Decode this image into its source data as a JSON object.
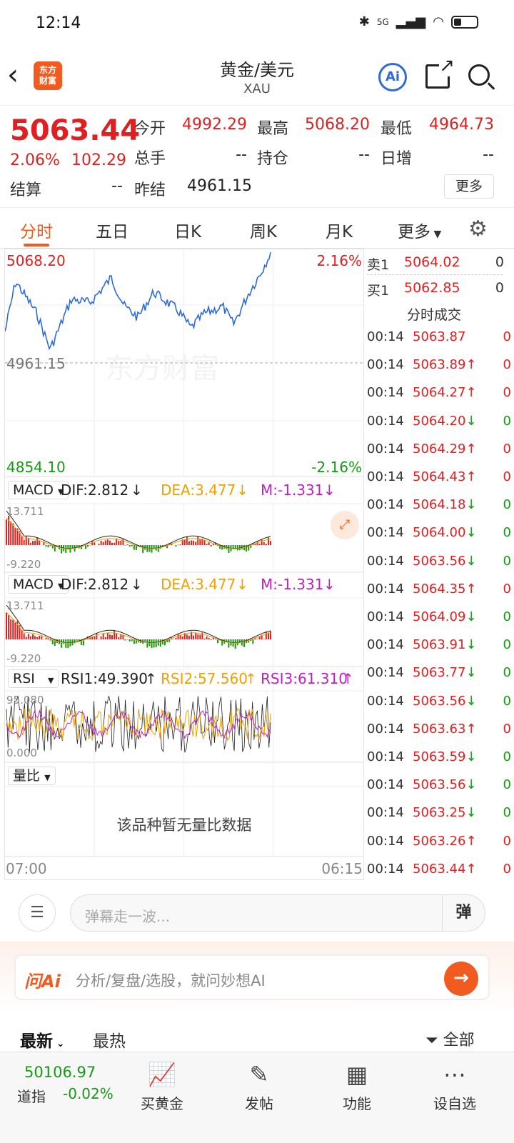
{
  "status": {
    "time": "12:14",
    "network": "5G"
  },
  "header": {
    "title": "黄金/美元",
    "code": "XAU",
    "logo_text": "东方财富",
    "ai_label": "Ai"
  },
  "quote": {
    "price": "5063.44",
    "pct": "2.06%",
    "change": "102.29",
    "labels": {
      "open": "今开",
      "high": "最高",
      "low": "最低",
      "volume": "总手",
      "position": "持仓",
      "daily_inc": "日增",
      "settle": "结算",
      "prev_settle": "昨结"
    },
    "open": "4992.29",
    "high": "5068.20",
    "low": "4964.73",
    "volume": "--",
    "position": "--",
    "daily_inc": "--",
    "settle": "--",
    "prev_settle": "4961.15",
    "more_button": "更多"
  },
  "tabs": [
    "分时",
    "五日",
    "日K",
    "周K",
    "月K",
    "更多"
  ],
  "chart": {
    "top_price": "5068.20",
    "top_pct": "2.16%",
    "mid_price": "4961.15",
    "bottom_price": "4854.10",
    "bottom_pct": "-2.16%",
    "watermark": "东方财富",
    "start_time": "07:00",
    "end_time": "06:15"
  },
  "macd": {
    "name": "MACD",
    "dif": "DIF:2.812",
    "dea": "DEA:3.477",
    "m": "M:-1.331",
    "max": "13.711",
    "min": "-9.220"
  },
  "macd2": {
    "name": "MACD",
    "dif": "DIF:2.812",
    "dea": "DEA:3.477",
    "m": "M:-1.331",
    "max": "13.711",
    "min": "-9.220"
  },
  "rsi": {
    "name": "RSI",
    "rsi1": "RSI1:49.390",
    "rsi2": "RSI2:57.560",
    "rsi3": "RSI3:61.310",
    "max": "95.080",
    "min": "0.000"
  },
  "volume_ratio": {
    "name": "量比",
    "empty_text": "该品种暂无量比数据"
  },
  "orderbook": {
    "sell": {
      "label": "卖1",
      "price": "5064.02",
      "vol": "0"
    },
    "buy": {
      "label": "买1",
      "price": "5062.85",
      "vol": "0"
    },
    "title": "分时成交"
  },
  "trades": [
    {
      "time": "00:14",
      "price": "5063.87",
      "arrow": "",
      "dir": "up",
      "vol": "0"
    },
    {
      "time": "00:14",
      "price": "5063.89",
      "arrow": "↑",
      "dir": "up",
      "vol": "0"
    },
    {
      "time": "00:14",
      "price": "5064.27",
      "arrow": "↑",
      "dir": "up",
      "vol": "0"
    },
    {
      "time": "00:14",
      "price": "5064.20",
      "arrow": "↓",
      "dir": "down",
      "vol": "0"
    },
    {
      "time": "00:14",
      "price": "5064.29",
      "arrow": "↑",
      "dir": "up",
      "vol": "0"
    },
    {
      "time": "00:14",
      "price": "5064.43",
      "arrow": "↑",
      "dir": "up",
      "vol": "0"
    },
    {
      "time": "00:14",
      "price": "5064.18",
      "arrow": "↓",
      "dir": "down",
      "vol": "0"
    },
    {
      "time": "00:14",
      "price": "5064.00",
      "arrow": "↓",
      "dir": "down",
      "vol": "0"
    },
    {
      "time": "00:14",
      "price": "5063.56",
      "arrow": "↓",
      "dir": "down",
      "vol": "0"
    },
    {
      "time": "00:14",
      "price": "5064.35",
      "arrow": "↑",
      "dir": "up",
      "vol": "0"
    },
    {
      "time": "00:14",
      "price": "5064.09",
      "arrow": "↓",
      "dir": "down",
      "vol": "0"
    },
    {
      "time": "00:14",
      "price": "5063.91",
      "arrow": "↓",
      "dir": "down",
      "vol": "0"
    },
    {
      "time": "00:14",
      "price": "5063.77",
      "arrow": "↓",
      "dir": "down",
      "vol": "0"
    },
    {
      "time": "00:14",
      "price": "5063.56",
      "arrow": "↓",
      "dir": "down",
      "vol": "0"
    },
    {
      "time": "00:14",
      "price": "5063.63",
      "arrow": "↑",
      "dir": "up",
      "vol": "0"
    },
    {
      "time": "00:14",
      "price": "5063.59",
      "arrow": "↓",
      "dir": "down",
      "vol": "0"
    },
    {
      "time": "00:14",
      "price": "5063.56",
      "arrow": "↓",
      "dir": "down",
      "vol": "0"
    },
    {
      "time": "00:14",
      "price": "5063.25",
      "arrow": "↓",
      "dir": "down",
      "vol": "0"
    },
    {
      "time": "00:14",
      "price": "5063.26",
      "arrow": "↑",
      "dir": "up",
      "vol": "0"
    },
    {
      "time": "00:14",
      "price": "5063.44",
      "arrow": "↑",
      "dir": "up",
      "vol": "0"
    }
  ],
  "comment": {
    "placeholder": "弹幕走一波...",
    "danmaku_button": "弹"
  },
  "ask_ai": {
    "logo": "问Ai",
    "placeholder": "分析/复盘/选股，就问妙想AI"
  },
  "feed_tabs": {
    "latest": "最新",
    "hot": "最热",
    "filter": "全部"
  },
  "bottom_nav": {
    "index_value": "50106.97",
    "index_name": "道指",
    "index_pct": "-0.02%",
    "items": [
      "买黄金",
      "发帖",
      "功能",
      "设自选"
    ]
  },
  "colors": {
    "up": "#e02020",
    "down": "#149a14",
    "accent": "#f25b1f",
    "price_line": "#2f6bd8",
    "dea": "#f0a000",
    "m": "#c020c0"
  }
}
